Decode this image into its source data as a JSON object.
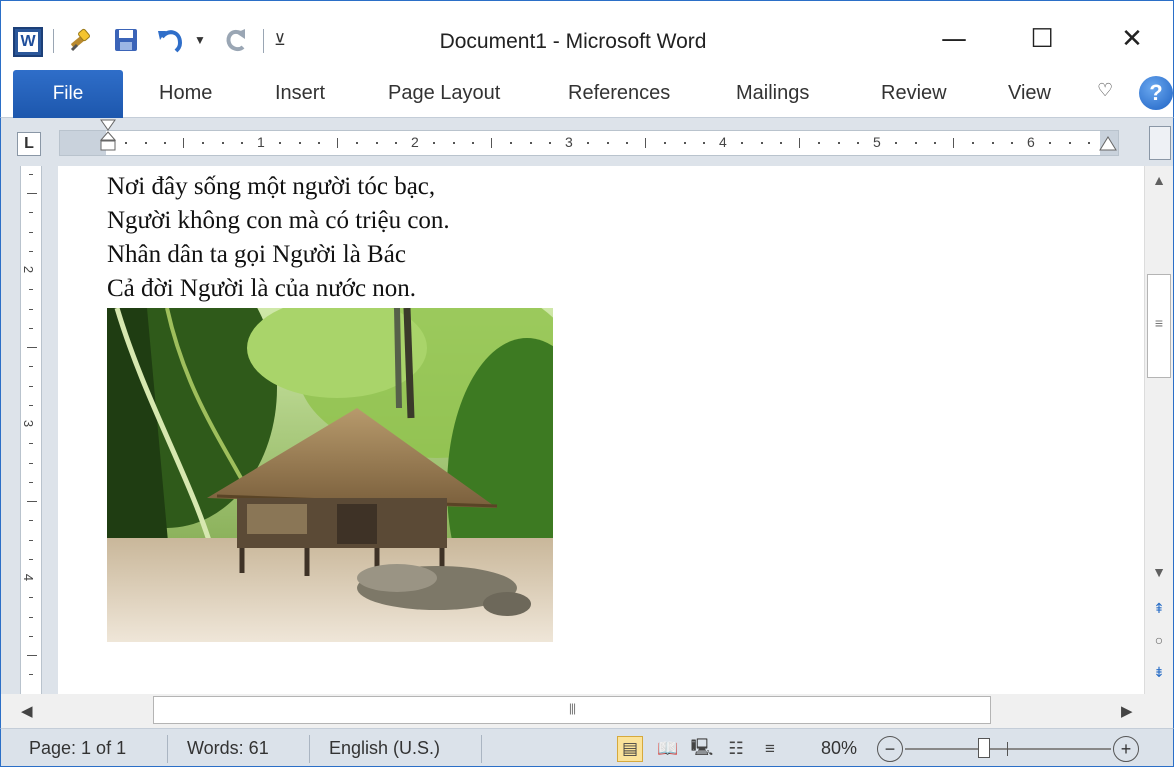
{
  "window": {
    "title": "Document1  -  Microsoft Word",
    "minimize_glyph": "—",
    "maximize_glyph": "☐",
    "close_glyph": "✕"
  },
  "quick_access": {
    "app_icon_letter": "W",
    "icons": [
      "word-app-icon",
      "format-painter-icon",
      "save-icon",
      "undo-icon",
      "redo-icon",
      "customize-qat-icon"
    ]
  },
  "ribbon": {
    "tabs": [
      {
        "label": "File",
        "active": true
      },
      {
        "label": "Home"
      },
      {
        "label": "Insert"
      },
      {
        "label": "Page Layout"
      },
      {
        "label": "References"
      },
      {
        "label": "Mailings"
      },
      {
        "label": "Review"
      },
      {
        "label": "View"
      }
    ],
    "help_label": "?"
  },
  "ruler": {
    "tab_selector": "L",
    "numbers": [
      "1",
      "2",
      "3",
      "4",
      "5",
      "6"
    ],
    "vertical_numbers": [
      "2",
      "3",
      "4"
    ]
  },
  "document": {
    "lines": [
      "Nơi đây sống một người tóc bạc,",
      "Người không con mà có triệu con.",
      "Nhân dân ta gọi Người là Bác",
      "Cả đời Người là của nước non."
    ],
    "image": "photo of a thatched stilt house in a bamboo forest"
  },
  "scrollbar": {
    "hthumb_grip": "|||",
    "vthumb_grip": "≡"
  },
  "status": {
    "page": "Page: 1 of 1",
    "words": "Words: 61",
    "language": "English (U.S.)",
    "zoom": "80%",
    "zoom_level": 0.8,
    "zoom_out": "−",
    "zoom_in": "+"
  },
  "colors": {
    "file_tab": "#1d57ad",
    "frame": "#2b6fc7",
    "status_bar": "#dbe2ea"
  }
}
